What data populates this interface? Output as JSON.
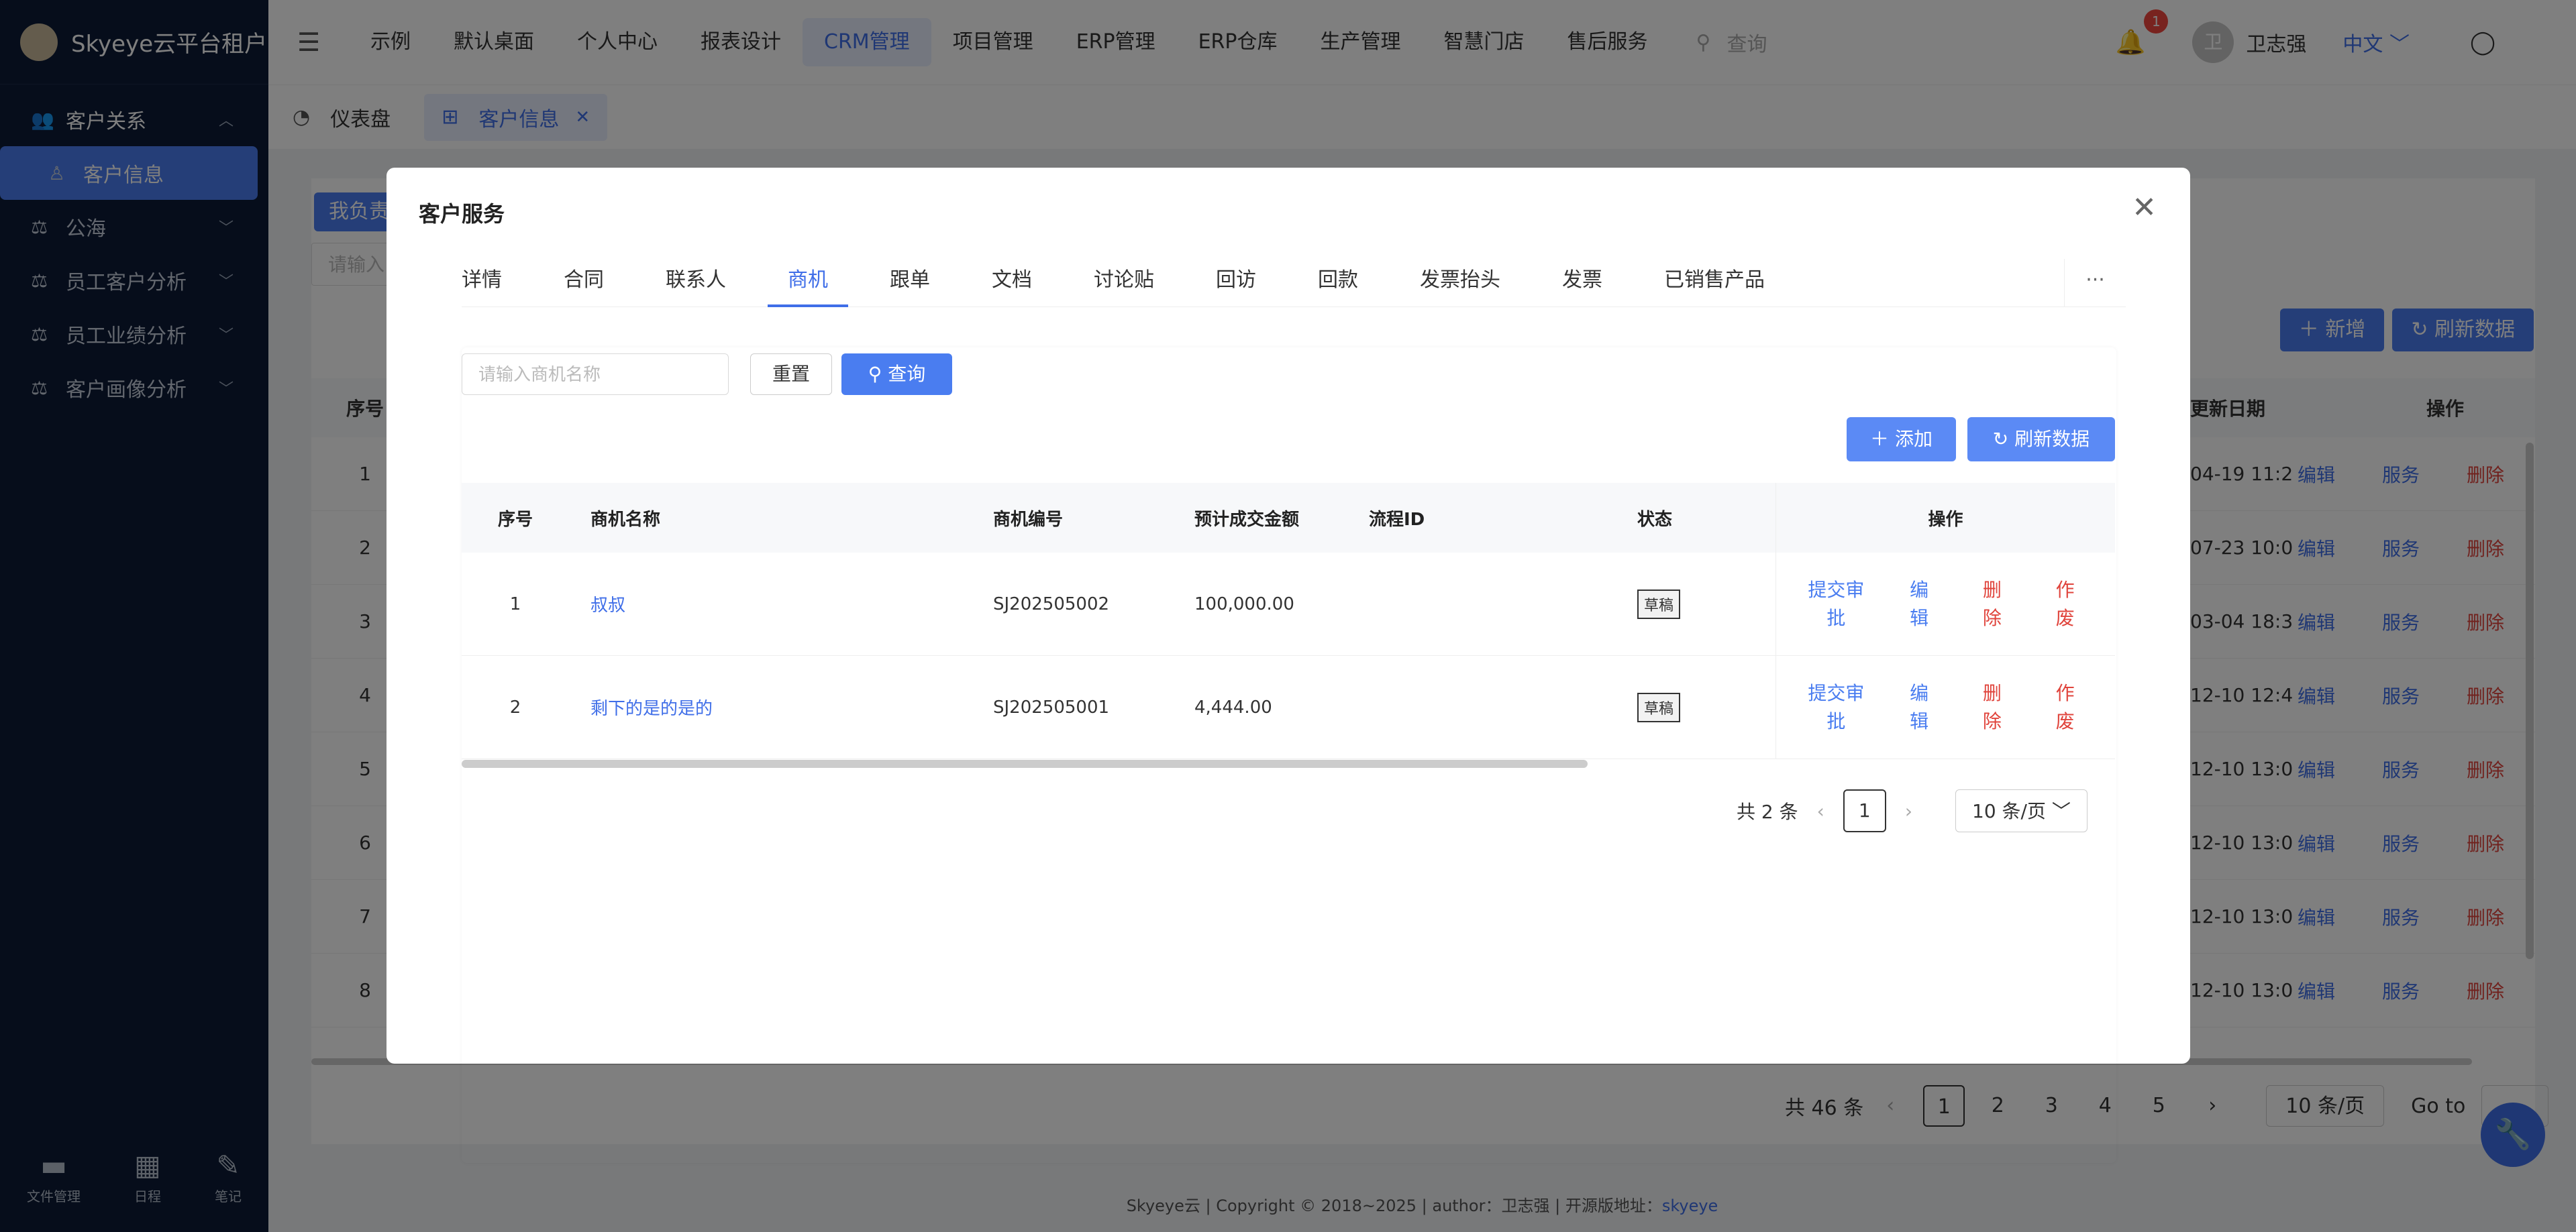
{
  "app": {
    "title": "Skyeye云平台租户"
  },
  "sidebar": {
    "items": [
      {
        "label": "客户关系",
        "icon": "users-icon"
      },
      {
        "label": "客户信息",
        "icon": "user-icon"
      },
      {
        "label": "公海",
        "icon": "scale-icon"
      },
      {
        "label": "员工客户分析",
        "icon": "scale-icon"
      },
      {
        "label": "员工业绩分析",
        "icon": "scale-icon"
      },
      {
        "label": "客户画像分析",
        "icon": "scale-icon"
      }
    ],
    "bottom": [
      {
        "label": "文件管理",
        "icon": "folder-icon"
      },
      {
        "label": "日程",
        "icon": "calendar-icon"
      },
      {
        "label": "笔记",
        "icon": "note-icon"
      }
    ]
  },
  "topnav": {
    "items": [
      "示例",
      "默认桌面",
      "个人中心",
      "报表设计",
      "CRM管理",
      "项目管理",
      "ERP管理",
      "ERP仓库",
      "生产管理",
      "智慧门店",
      "售后服务"
    ],
    "search_placeholder": "查询",
    "notification_count": "1",
    "avatar_text": "卫",
    "user_name": "卫志强",
    "language": "中文"
  },
  "page_tabs": [
    {
      "label": "仪表盘",
      "icon": "dashboard-icon"
    },
    {
      "label": "客户信息",
      "icon": "grid-icon",
      "close": "✕"
    }
  ],
  "background": {
    "mine_btn": "我负责",
    "search_placeholder": "请输入",
    "add_btn": "新增",
    "refresh_btn": "刷新数据",
    "header": {
      "seq": "序号",
      "date": "更新日期",
      "ops": "操作"
    },
    "rows": [
      {
        "seq": "1",
        "date": "04-19 11:2"
      },
      {
        "seq": "2",
        "date": "07-23 10:0"
      },
      {
        "seq": "3",
        "date": "03-04 18:3"
      },
      {
        "seq": "4",
        "date": "12-10 12:4"
      },
      {
        "seq": "5",
        "date": "12-10 13:0"
      },
      {
        "seq": "6",
        "date": "12-10 13:0"
      },
      {
        "seq": "7",
        "date": "12-10 13:0"
      },
      {
        "seq": "8",
        "date": "12-10 13:0"
      }
    ],
    "row_ops": {
      "edit": "编辑",
      "service": "服务",
      "delete": "删除"
    },
    "pager": {
      "total": "共 46 条",
      "pages": [
        "1",
        "2",
        "3",
        "4",
        "5"
      ],
      "size": "10 条/页",
      "goto": "Go to"
    }
  },
  "footer": {
    "text": "Skyeye云 | Copyright © 2018~2025 | author：卫志强 | 开源版地址：",
    "link": "skyeye"
  },
  "modal": {
    "title": "客户服务",
    "tabs": [
      "详情",
      "合同",
      "联系人",
      "商机",
      "跟单",
      "文档",
      "讨论贴",
      "回访",
      "回款",
      "发票抬头",
      "发票",
      "已销售产品"
    ],
    "more": "···",
    "search_placeholder": "请输入商机名称",
    "reset_btn": "重置",
    "query_btn": "查询",
    "add_btn": "添加",
    "refresh_btn": "刷新数据",
    "table": {
      "headers": {
        "seq": "序号",
        "name": "商机名称",
        "code": "商机编号",
        "amount": "预计成交金额",
        "flow": "流程ID",
        "status": "状态",
        "ops": "操作"
      },
      "rows": [
        {
          "seq": "1",
          "name": "叔叔",
          "code": "SJ202505002",
          "amount": "100,000.00",
          "flow": "",
          "status": "草稿"
        },
        {
          "seq": "2",
          "name": "剩下的是的是的",
          "code": "SJ202505001",
          "amount": "4,444.00",
          "flow": "",
          "status": "草稿"
        }
      ],
      "ops": {
        "submit_a": "提交审",
        "submit_b": "批",
        "edit_a": "编",
        "edit_b": "辑",
        "delete_a": "删",
        "delete_b": "除",
        "void_a": "作",
        "void_b": "废"
      }
    },
    "pager": {
      "total": "共 2 条",
      "current": "1",
      "size": "10 条/页"
    }
  }
}
